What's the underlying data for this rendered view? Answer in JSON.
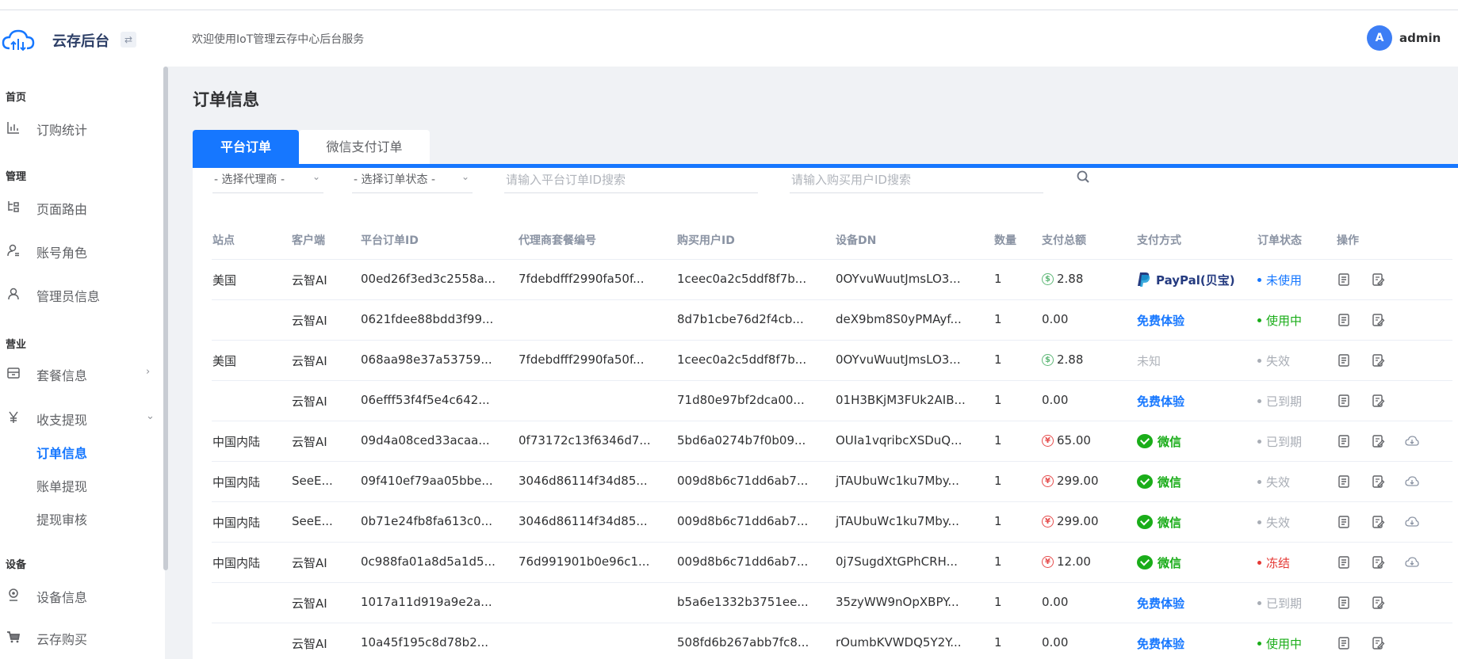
{
  "app": {
    "title": "云存后台",
    "collapse_glyph": "⇄",
    "welcome": "欢迎使用IoT管理云存中心后台服务",
    "user": {
      "avatar_letter": "A",
      "name": "admin"
    }
  },
  "sidebar": {
    "groups": [
      {
        "label": "首页"
      },
      {
        "label": "管理"
      },
      {
        "label": "营业"
      },
      {
        "label": "设备"
      }
    ],
    "items": [
      {
        "label": "订购统计",
        "icon": "bar-chart-icon"
      },
      {
        "label": "页面路由",
        "icon": "route-icon"
      },
      {
        "label": "账号角色",
        "icon": "user-role-icon"
      },
      {
        "label": "管理员信息",
        "icon": "user-icon"
      },
      {
        "label": "套餐信息",
        "icon": "package-icon",
        "arrow": "›"
      },
      {
        "label": "收支提现",
        "icon": "yen-icon",
        "arrow": "⌄"
      },
      {
        "label": "设备信息",
        "icon": "device-icon"
      },
      {
        "label": "云存购买",
        "icon": "cart-icon"
      }
    ],
    "sub_items": [
      {
        "label": "订单信息",
        "active": true
      },
      {
        "label": "账单提现",
        "active": false
      },
      {
        "label": "提现审核",
        "active": false
      }
    ]
  },
  "page": {
    "title": "订单信息",
    "tabs": [
      {
        "label": "平台订单",
        "active": true
      },
      {
        "label": "微信支付订单",
        "active": false
      }
    ]
  },
  "filters": {
    "agent_select": "- 选择代理商 -",
    "status_select": "- 选择订单状态 -",
    "order_id_placeholder": "请输入平台订单ID搜索",
    "user_id_placeholder": "请输入购买用户ID搜索"
  },
  "table": {
    "columns": [
      "站点",
      "客户端",
      "平台订单ID",
      "代理商套餐编号",
      "购买用户ID",
      "设备DN",
      "数量",
      "支付总额",
      "支付方式",
      "订单状态",
      "操作"
    ],
    "rows": [
      {
        "site": "美国",
        "client": "云智AI",
        "order_id": "00ed26f3ed3c2558a...",
        "package_no": "7fdebdfff2990fa50f...",
        "user_id": "1ceec0a2c5ddf8f7b...",
        "device_dn": "0OYvuWuutJmsLO3...",
        "qty": "1",
        "amount": "2.88",
        "currency": "usd",
        "currency_glyph": "$",
        "method": "PayPal(贝宝)",
        "method_type": "paypal",
        "status": "未使用",
        "status_type": "unused",
        "cloud": false
      },
      {
        "site": "",
        "client": "云智AI",
        "order_id": "0621fdee88bdd3f99...",
        "package_no": "",
        "user_id": "8d7b1cbe76d2f4cb...",
        "device_dn": "deX9bm8S0yPMAyf...",
        "qty": "1",
        "amount": "0.00",
        "currency": "",
        "currency_glyph": "",
        "method": "免费体验",
        "method_type": "free",
        "status": "使用中",
        "status_type": "using",
        "cloud": false
      },
      {
        "site": "美国",
        "client": "云智AI",
        "order_id": "068aa98e37a53759...",
        "package_no": "7fdebdfff2990fa50f...",
        "user_id": "1ceec0a2c5ddf8f7b...",
        "device_dn": "0OYvuWuutJmsLO3...",
        "qty": "1",
        "amount": "2.88",
        "currency": "usd",
        "currency_glyph": "$",
        "method": "未知",
        "method_type": "unknown",
        "status": "失效",
        "status_type": "invalid",
        "cloud": false
      },
      {
        "site": "",
        "client": "云智AI",
        "order_id": "06efff53f4f5e4c642...",
        "package_no": "",
        "user_id": "71d80e97bf2dca00...",
        "device_dn": "01H3BKjM3FUk2AIB...",
        "qty": "1",
        "amount": "0.00",
        "currency": "",
        "currency_glyph": "",
        "method": "免费体验",
        "method_type": "free",
        "status": "已到期",
        "status_type": "expired",
        "cloud": false
      },
      {
        "site": "中国内陆",
        "client": "云智AI",
        "order_id": "09d4a08ced33acaa...",
        "package_no": "0f73172c13f6346d7...",
        "user_id": "5bd6a0274b7f0b09...",
        "device_dn": "OUIa1vqribcXSDuQ...",
        "qty": "1",
        "amount": "65.00",
        "currency": "cny",
        "currency_glyph": "¥",
        "method": "微信",
        "method_type": "wechat",
        "status": "已到期",
        "status_type": "expired",
        "cloud": true
      },
      {
        "site": "中国内陆",
        "client": "SeeE...",
        "order_id": "09f410ef79aa05bbe...",
        "package_no": "3046d86114f34d85...",
        "user_id": "009d8b6c71dd6ab7...",
        "device_dn": "jTAUbuWc1ku7Mby...",
        "qty": "1",
        "amount": "299.00",
        "currency": "cny",
        "currency_glyph": "¥",
        "method": "微信",
        "method_type": "wechat",
        "status": "失效",
        "status_type": "invalid",
        "cloud": true
      },
      {
        "site": "中国内陆",
        "client": "SeeE...",
        "order_id": "0b71e24fb8fa613c0...",
        "package_no": "3046d86114f34d85...",
        "user_id": "009d8b6c71dd6ab7...",
        "device_dn": "jTAUbuWc1ku7Mby...",
        "qty": "1",
        "amount": "299.00",
        "currency": "cny",
        "currency_glyph": "¥",
        "method": "微信",
        "method_type": "wechat",
        "status": "失效",
        "status_type": "invalid",
        "cloud": true
      },
      {
        "site": "中国内陆",
        "client": "云智AI",
        "order_id": "0c988fa01a8d5a1d5...",
        "package_no": "76d991901b0e96c1...",
        "user_id": "009d8b6c71dd6ab7...",
        "device_dn": "0j7SugdXtGPhCRH...",
        "qty": "1",
        "amount": "12.00",
        "currency": "cny",
        "currency_glyph": "¥",
        "method": "微信",
        "method_type": "wechat",
        "status": "冻结",
        "status_type": "frozen",
        "cloud": true
      },
      {
        "site": "",
        "client": "云智AI",
        "order_id": "1017a11d919a9e2a...",
        "package_no": "",
        "user_id": "b5a6e1332b3751ee...",
        "device_dn": "35zyWW9nOpXBPY...",
        "qty": "1",
        "amount": "0.00",
        "currency": "",
        "currency_glyph": "",
        "method": "免费体验",
        "method_type": "free",
        "status": "已到期",
        "status_type": "expired",
        "cloud": false
      },
      {
        "site": "",
        "client": "云智AI",
        "order_id": "10a45f195c8d78b2...",
        "package_no": "",
        "user_id": "508fd6b267abb7fc8...",
        "device_dn": "rOumbKVWDQ5Y2Y...",
        "qty": "1",
        "amount": "0.00",
        "currency": "",
        "currency_glyph": "",
        "method": "免费体验",
        "method_type": "free",
        "status": "使用中",
        "status_type": "using",
        "cloud": false
      }
    ]
  },
  "colors": {
    "primary": "#1677ff",
    "wechat": "#1aad19",
    "frozen": "#e53935",
    "muted": "#a8adb5"
  }
}
